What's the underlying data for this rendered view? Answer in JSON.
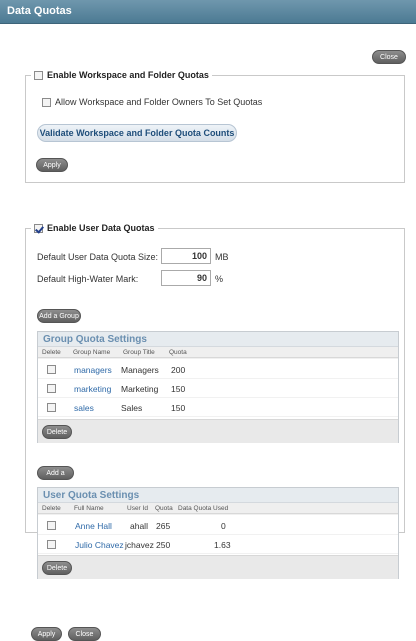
{
  "window": {
    "title": "Data Quotas"
  },
  "top_close_label": "Close",
  "workspace": {
    "legend": "Enable Workspace and Folder Quotas",
    "allow_owners_label": "Allow Workspace and Folder Owners To Set Quotas",
    "validate_label": "Validate Workspace and Folder Quota Counts",
    "apply_label": "Apply"
  },
  "user_quotas": {
    "legend": "Enable User Data Quotas",
    "default_size_label": "Default User Data Quota Size:",
    "default_size_value": "100",
    "default_size_unit": "MB",
    "hwm_label": "Default High-Water Mark:",
    "hwm_value": "90",
    "hwm_unit": "%",
    "add_group_label": "Add a Group",
    "add_user_label": "Add a User"
  },
  "group_settings": {
    "title": "Group Quota Settings",
    "headers": [
      "Delete",
      "Group Name",
      "Group Title",
      "Quota"
    ],
    "rows": [
      {
        "name": "managers",
        "title": "Managers",
        "quota": "200"
      },
      {
        "name": "marketing",
        "title": "Marketing",
        "quota": "150"
      },
      {
        "name": "sales",
        "title": "Sales",
        "quota": "150"
      }
    ],
    "delete_label": "Delete"
  },
  "user_settings": {
    "title": "User Quota Settings",
    "headers": [
      "Delete",
      "Full Name",
      "User Id",
      "Quota",
      "Data Quota Used"
    ],
    "rows": [
      {
        "name": "Anne Hall",
        "id": "ahall",
        "quota": "265",
        "used": "0"
      },
      {
        "name": "Julio Chavez",
        "id": "jchavez",
        "quota": "250",
        "used": "1.63"
      }
    ],
    "delete_label": "Delete"
  },
  "footer": {
    "apply_label": "Apply",
    "close_label": "Close"
  }
}
